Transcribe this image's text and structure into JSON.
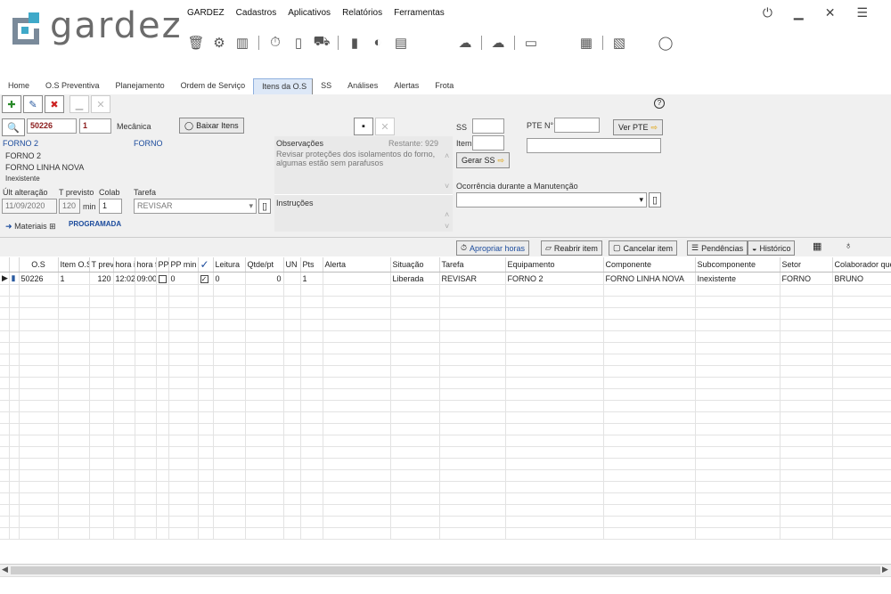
{
  "app": {
    "brand": "gardez"
  },
  "menu": [
    "GARDEZ",
    "Cadastros",
    "Aplicativos",
    "Relatórios",
    "Ferramentas"
  ],
  "tabs": [
    "Home",
    "O.S Preventiva",
    "Planejamento",
    "Ordem de Serviço",
    "Itens da O.S",
    "SS",
    "Análises",
    "Alertas",
    "Frota"
  ],
  "search": {
    "os": "50226",
    "item": "1",
    "group": "Mecânica",
    "baixar_label": "Baixar Itens"
  },
  "equipment": {
    "header_left": "FORNO 2",
    "header_right": "FORNO",
    "line1": "FORNO 2",
    "line2": "FORNO LINHA NOVA",
    "line3": "Inexistente"
  },
  "form": {
    "ult_alteracao_label": "Últ alteração",
    "ult_alteracao": "11/09/2020",
    "t_previsto_label": "T previsto",
    "t_previsto": "120",
    "min_label": "min",
    "colab_label": "Colab",
    "colab": "1",
    "tarefa_label": "Tarefa",
    "tarefa": "REVISAR",
    "materiais_label": "Materiais",
    "programada": "PROGRAMADA"
  },
  "obs": {
    "label": "Observações",
    "restante": "Restante: 929",
    "text": "Revisar proteções dos isolamentos do forno, algumas estão sem parafusos",
    "instrucoes_label": "Instruções"
  },
  "ss": {
    "ss_label": "SS",
    "item_label": "Item",
    "gerar_label": "Gerar SS",
    "pte_label": "PTE N°",
    "ver_pte_label": "Ver PTE",
    "ocorrencia_label": "Ocorrência durante a Manutenção"
  },
  "actions": {
    "apropriar": "Apropriar horas",
    "reabrir": "Reabrir item",
    "cancelar": "Cancelar item",
    "pendencias": "Pendências",
    "historico": "Histórico"
  },
  "table": {
    "columns": [
      "O.S",
      "Item O.S",
      "T prev",
      "hora i",
      "hora f",
      "PP",
      "PP min",
      "✓",
      "Leitura",
      "Qtde/pt",
      "UN",
      "Pts",
      "Alerta",
      "Situação",
      "Tarefa",
      "Equipamento",
      "Componente",
      "Subcomponente",
      "Setor",
      "Colaborador que fe"
    ],
    "rows": [
      [
        "50226",
        "1",
        "120",
        "12:02",
        "09:00",
        "",
        "0",
        "",
        "0",
        "0",
        "",
        "1",
        "",
        "Liberada",
        "REVISAR",
        "FORNO 2",
        "FORNO LINHA NOVA",
        "Inexistente",
        "FORNO",
        "BRUNO"
      ]
    ]
  }
}
